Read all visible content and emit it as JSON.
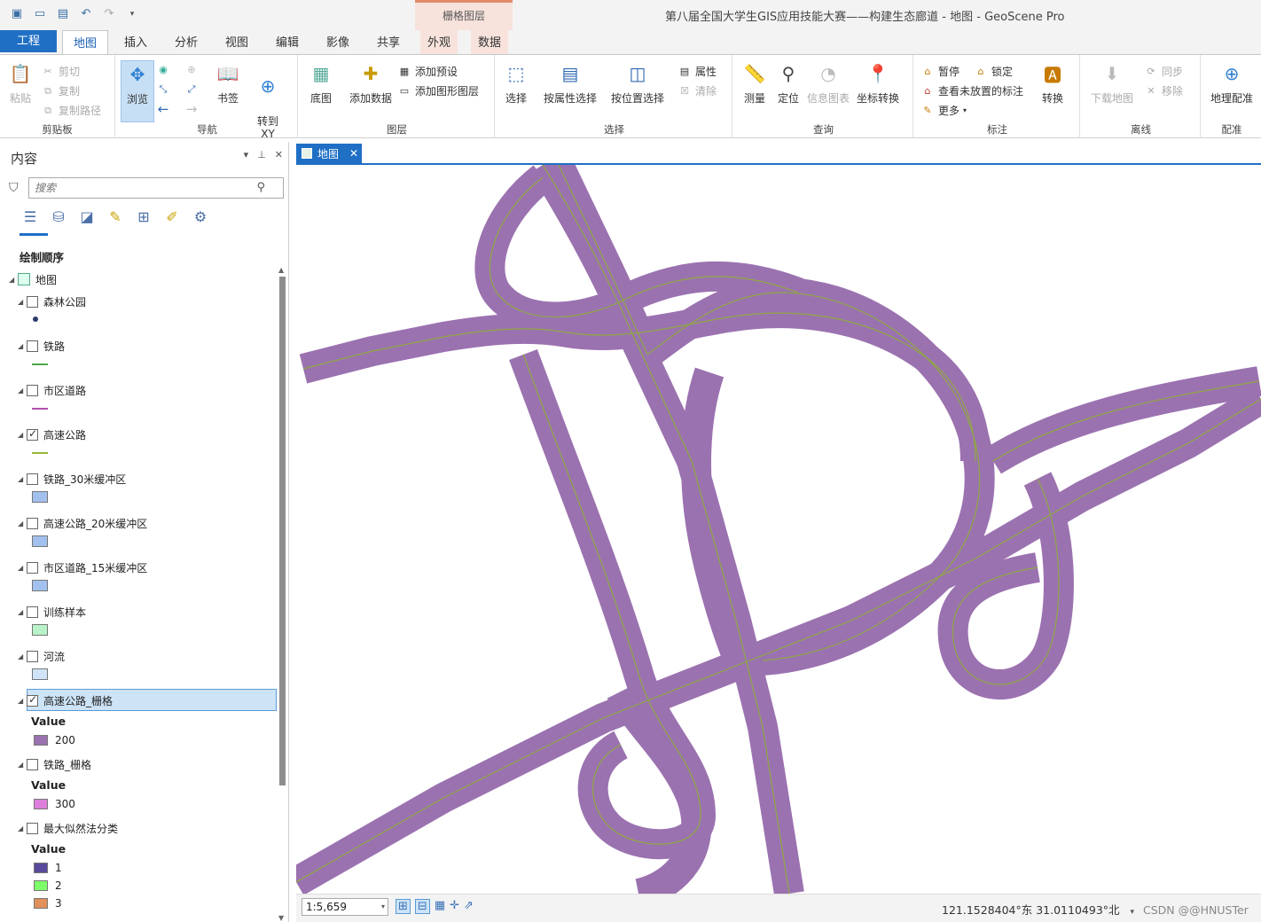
{
  "window": {
    "title": "第八届全国大学生GIS应用技能大赛——构建生态廊道 - 地图 - GeoScene Pro"
  },
  "contextual_tab": {
    "label": "栅格图层"
  },
  "tabs": [
    "工程",
    "地图",
    "插入",
    "分析",
    "视图",
    "编辑",
    "影像",
    "共享",
    "外观",
    "数据"
  ],
  "ribbon": {
    "clipboard": {
      "label": "剪贴板",
      "paste": "粘贴",
      "cut": "剪切",
      "copy": "复制",
      "copy_path": "复制路径"
    },
    "navigate": {
      "label": "导航",
      "explore": "浏览",
      "bookmarks": "书签",
      "goto_xy": "转到\nXY"
    },
    "layer": {
      "label": "图层",
      "basemap": "底图",
      "add_data": "添加数据",
      "add_preset": "添加预设",
      "add_graphics_layer": "添加图形图层"
    },
    "selection": {
      "label": "选择",
      "select": "选择",
      "select_by_attributes": "按属性选择",
      "select_by_location": "按位置选择",
      "attributes": "属性",
      "clear": "清除"
    },
    "inquiry": {
      "label": "查询",
      "measure": "测量",
      "locate": "定位",
      "infographics": "信息图表",
      "convert_coords": "坐标转换"
    },
    "labeling": {
      "label": "标注",
      "pause": "暂停",
      "lock": "锁定",
      "view_unplaced": "查看未放置的标注",
      "more": "更多",
      "convert": "转换"
    },
    "offline": {
      "label": "离线",
      "download_map": "下载地图",
      "sync": "同步",
      "remove": "移除"
    },
    "georef": {
      "label": "配准",
      "georeference": "地理配准"
    }
  },
  "contents": {
    "title": "内容",
    "search_placeholder": "搜索",
    "draw_order": "绘制顺序",
    "map_name": "地图",
    "layers": [
      {
        "name": "森林公园",
        "checked": false
      },
      {
        "name": "铁路",
        "checked": false
      },
      {
        "name": "市区道路",
        "checked": false
      },
      {
        "name": "高速公路",
        "checked": true
      },
      {
        "name": "铁路_30米缓冲区",
        "checked": false
      },
      {
        "name": "高速公路_20米缓冲区",
        "checked": false
      },
      {
        "name": "市区道路_15米缓冲区",
        "checked": false
      },
      {
        "name": "训练样本",
        "checked": false
      },
      {
        "name": "河流",
        "checked": false
      },
      {
        "name": "高速公路_栅格",
        "checked": true
      },
      {
        "name": "铁路_栅格",
        "checked": false
      },
      {
        "name": "最大似然法分类",
        "checked": false
      }
    ],
    "value_title": "Value",
    "highway_raster_value": "200",
    "rail_raster_value": "300",
    "classes": [
      "1",
      "2",
      "3"
    ],
    "colors": {
      "highway_raster": "#9b72b0",
      "rail_raster": "#dd7fdb",
      "class1": "#5a4a9a",
      "class2": "#7dff6a",
      "class3": "#e0905a"
    }
  },
  "map": {
    "tab_label": "地图",
    "road_fill": "#9b72b0",
    "centerline": "#8fa842"
  },
  "status": {
    "scale": "1:5,659",
    "coords": "121.1528404°东 31.0110493°北",
    "watermark": "CSDN @@HNUSTer"
  }
}
